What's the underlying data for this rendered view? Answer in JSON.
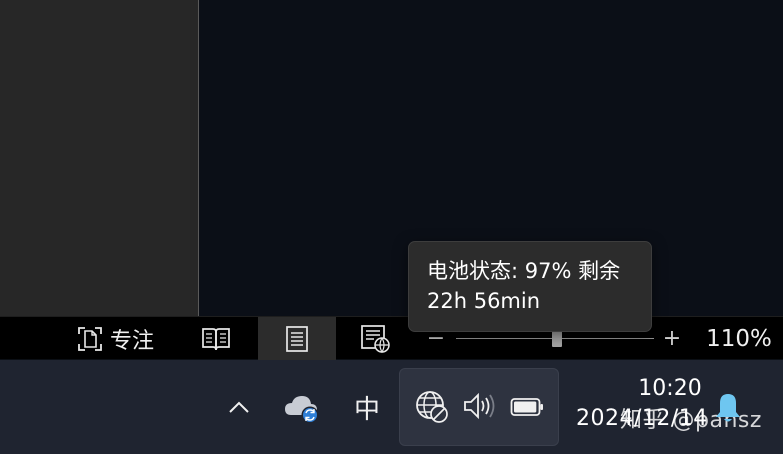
{
  "status_bar": {
    "focus_label": "专注",
    "zoom_minus": "−",
    "zoom_plus": "+",
    "zoom_level": "110%"
  },
  "taskbar": {
    "ime_label": "中",
    "time": "10:20",
    "date": "2024/12/14",
    "watermark": "知乎 @pansz"
  },
  "tooltip": {
    "line1": "电池状态: 97% 剩余",
    "line2": "22h 56min"
  },
  "zoom": {
    "percent": 110
  },
  "battery": {
    "percent": 97
  },
  "icons": [
    "focus-icon",
    "read-mode-icon",
    "print-layout-icon",
    "web-layout-icon",
    "chevron-up-icon",
    "onedrive-sync-icon",
    "network-blocked-icon",
    "volume-icon",
    "battery-icon",
    "notification-bell-icon"
  ],
  "colors": {
    "taskbar": "#1f2430",
    "status_bar": "#000000",
    "tooltip": "#2c2c2c",
    "bell": "#6ec6f0"
  }
}
